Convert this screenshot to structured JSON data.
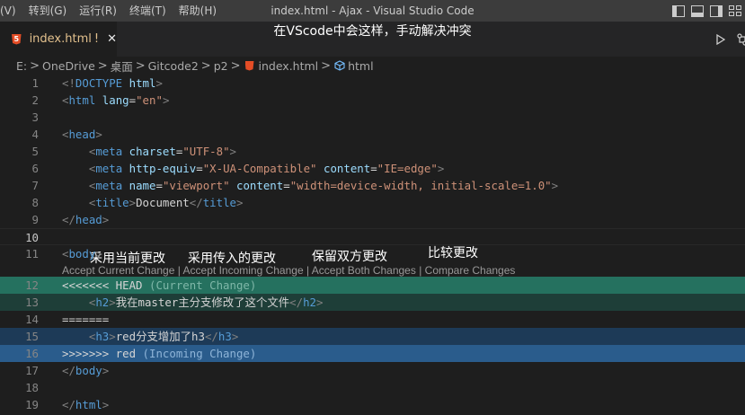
{
  "menu": [
    "(V)",
    "转到(G)",
    "运行(R)",
    "终端(T)",
    "帮助(H)"
  ],
  "window_title": "index.html - Ajax - Visual Studio Code",
  "tab": {
    "label": "index.html",
    "modified_marker": "!",
    "close": "✕"
  },
  "annotations": {
    "top": "在VScode中会这样，手动解决冲突",
    "accept_current": "采用当前更改",
    "accept_incoming": "采用传入的更改",
    "accept_both": "保留双方更改",
    "compare": "比较更改"
  },
  "breadcrumb": [
    "E:",
    "OneDrive",
    "桌面",
    "Gitcode2",
    "p2",
    "index.html",
    "html"
  ],
  "codelens": {
    "accept_current": "Accept Current Change",
    "accept_incoming": "Accept Incoming Change",
    "accept_both": "Accept Both Changes",
    "compare": "Compare Changes",
    "separator": "|"
  },
  "lines": [
    {
      "num": "1",
      "kind": "doctype",
      "parts": [
        [
          "t-tag",
          "<!"
        ],
        [
          "t-name",
          "DOCTYPE "
        ],
        [
          "t-attr",
          "html"
        ],
        [
          "t-tag",
          ">"
        ]
      ]
    },
    {
      "num": "2",
      "parts": [
        [
          "t-tag",
          "<"
        ],
        [
          "t-name",
          "html "
        ],
        [
          "t-attr",
          "lang"
        ],
        [
          "t-text",
          "="
        ],
        [
          "t-str",
          "\"en\""
        ],
        [
          "t-tag",
          ">"
        ]
      ]
    },
    {
      "num": "3",
      "parts": []
    },
    {
      "num": "4",
      "parts": [
        [
          "t-tag",
          "<"
        ],
        [
          "t-name",
          "head"
        ],
        [
          "t-tag",
          ">"
        ]
      ]
    },
    {
      "num": "5",
      "parts": [
        [
          "t-text",
          "    "
        ],
        [
          "t-tag",
          "<"
        ],
        [
          "t-name",
          "meta "
        ],
        [
          "t-attr",
          "charset"
        ],
        [
          "t-text",
          "="
        ],
        [
          "t-str",
          "\"UTF-8\""
        ],
        [
          "t-tag",
          ">"
        ]
      ]
    },
    {
      "num": "6",
      "parts": [
        [
          "t-text",
          "    "
        ],
        [
          "t-tag",
          "<"
        ],
        [
          "t-name",
          "meta "
        ],
        [
          "t-attr",
          "http-equiv"
        ],
        [
          "t-text",
          "="
        ],
        [
          "t-str",
          "\"X-UA-Compatible\" "
        ],
        [
          "t-attr",
          "content"
        ],
        [
          "t-text",
          "="
        ],
        [
          "t-str",
          "\"IE=edge\""
        ],
        [
          "t-tag",
          ">"
        ]
      ]
    },
    {
      "num": "7",
      "parts": [
        [
          "t-text",
          "    "
        ],
        [
          "t-tag",
          "<"
        ],
        [
          "t-name",
          "meta "
        ],
        [
          "t-attr",
          "name"
        ],
        [
          "t-text",
          "="
        ],
        [
          "t-str",
          "\"viewport\" "
        ],
        [
          "t-attr",
          "content"
        ],
        [
          "t-text",
          "="
        ],
        [
          "t-str",
          "\"width=device-width, initial-scale=1.0\""
        ],
        [
          "t-tag",
          ">"
        ]
      ]
    },
    {
      "num": "8",
      "parts": [
        [
          "t-text",
          "    "
        ],
        [
          "t-tag",
          "<"
        ],
        [
          "t-name",
          "title"
        ],
        [
          "t-tag",
          ">"
        ],
        [
          "t-text",
          "Document"
        ],
        [
          "t-tag",
          "</"
        ],
        [
          "t-name",
          "title"
        ],
        [
          "t-tag",
          ">"
        ]
      ]
    },
    {
      "num": "9",
      "parts": [
        [
          "t-tag",
          "</"
        ],
        [
          "t-name",
          "head"
        ],
        [
          "t-tag",
          ">"
        ]
      ]
    },
    {
      "num": "10",
      "active": true,
      "parts": []
    },
    {
      "num": "11",
      "parts": [
        [
          "t-tag",
          "<"
        ],
        [
          "t-name",
          "body"
        ],
        [
          "t-tag",
          ">"
        ]
      ]
    },
    {
      "num": "12",
      "bg": "current-header",
      "parts": [
        [
          "t-marker",
          "<<<<<<< HEAD "
        ],
        [
          "t-hint-c",
          "(Current Change)"
        ]
      ]
    },
    {
      "num": "13",
      "bg": "current-body",
      "parts": [
        [
          "t-text",
          "    "
        ],
        [
          "t-tag",
          "<"
        ],
        [
          "t-name",
          "h2"
        ],
        [
          "t-tag",
          ">"
        ],
        [
          "t-text",
          "我在master主分支修改了这个文件"
        ],
        [
          "t-tag",
          "</"
        ],
        [
          "t-name",
          "h2"
        ],
        [
          "t-tag",
          ">"
        ]
      ]
    },
    {
      "num": "14",
      "parts": [
        [
          "t-marker",
          "======="
        ]
      ]
    },
    {
      "num": "15",
      "bg": "incoming-body",
      "parts": [
        [
          "t-text",
          "    "
        ],
        [
          "t-tag",
          "<"
        ],
        [
          "t-name",
          "h3"
        ],
        [
          "t-tag",
          ">"
        ],
        [
          "t-text",
          "red分支增加了h3"
        ],
        [
          "t-tag",
          "</"
        ],
        [
          "t-name",
          "h3"
        ],
        [
          "t-tag",
          ">"
        ]
      ]
    },
    {
      "num": "16",
      "bg": "incoming-header",
      "parts": [
        [
          "t-marker",
          ">>>>>>> red "
        ],
        [
          "t-hint-i",
          "(Incoming Change)"
        ]
      ]
    },
    {
      "num": "17",
      "parts": [
        [
          "t-tag",
          "</"
        ],
        [
          "t-name",
          "body"
        ],
        [
          "t-tag",
          ">"
        ]
      ]
    },
    {
      "num": "18",
      "parts": []
    },
    {
      "num": "19",
      "parts": [
        [
          "t-tag",
          "</"
        ],
        [
          "t-name",
          "html"
        ],
        [
          "t-tag",
          ">"
        ]
      ]
    }
  ],
  "colors": {
    "current_header_bg": "#25715f",
    "current_body_bg": "#1e3e38",
    "incoming_body_bg": "#1d3a57",
    "incoming_header_bg": "#2a5c8c",
    "tag_name": "#569cd6",
    "attribute": "#9cdcfe",
    "string": "#ce9178",
    "modified_tab": "#e2c08d"
  },
  "icons": [
    "html5-icon",
    "close-icon",
    "run-icon",
    "branch-compare-icon",
    "layout-sidebar-icon",
    "layout-panel-icon",
    "layout-sidebar-right-icon",
    "customize-layout-icon",
    "symbol-element-icon"
  ]
}
